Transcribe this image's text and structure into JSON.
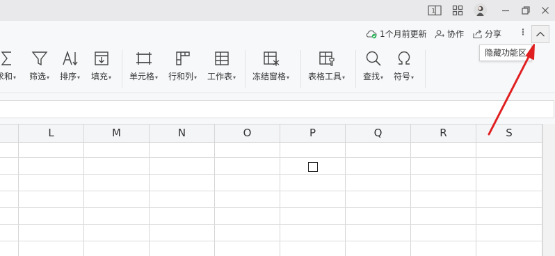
{
  "titlebar": {
    "icons": [
      "layout-icon",
      "grid-apps-icon",
      "avatar",
      "minimize-icon",
      "restore-icon",
      "close-icon"
    ],
    "layout_label": "1"
  },
  "actionbar": {
    "sync_status": "1个月前更新",
    "collaborate": "协作",
    "share": "分享",
    "more": "⋮",
    "collapse_tooltip": "隐藏功能区"
  },
  "ribbon": {
    "items": [
      {
        "label": "求和",
        "icon": "sigma-icon"
      },
      {
        "label": "筛选",
        "icon": "filter-icon"
      },
      {
        "label": "排序",
        "icon": "sort-icon"
      },
      {
        "label": "填充",
        "icon": "fill-icon"
      },
      {
        "label": "单元格",
        "icon": "cell-icon"
      },
      {
        "label": "行和列",
        "icon": "row-col-icon"
      },
      {
        "label": "工作表",
        "icon": "worksheet-icon"
      },
      {
        "label": "冻结窗格",
        "icon": "freeze-icon"
      },
      {
        "label": "表格工具",
        "icon": "table-tools-icon"
      },
      {
        "label": "查找",
        "icon": "search-icon"
      },
      {
        "label": "符号",
        "icon": "omega-icon"
      }
    ]
  },
  "sheet": {
    "columns": [
      "L",
      "M",
      "N",
      "O",
      "P",
      "Q",
      "R",
      "S"
    ]
  },
  "annotation": {
    "color": "#e02020"
  }
}
